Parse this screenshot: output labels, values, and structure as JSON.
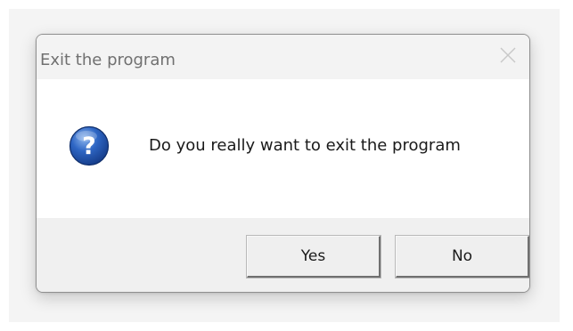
{
  "dialog": {
    "title": "Exit the program",
    "message": "Do you really want to exit the program",
    "icon": "question-icon",
    "buttons": {
      "yes_label": "Yes",
      "no_label": "No"
    }
  },
  "colors": {
    "icon_blue": "#1c4fa8",
    "title_text": "#707070",
    "body_background": "#ffffff",
    "footer_background": "#f0f0f0"
  }
}
